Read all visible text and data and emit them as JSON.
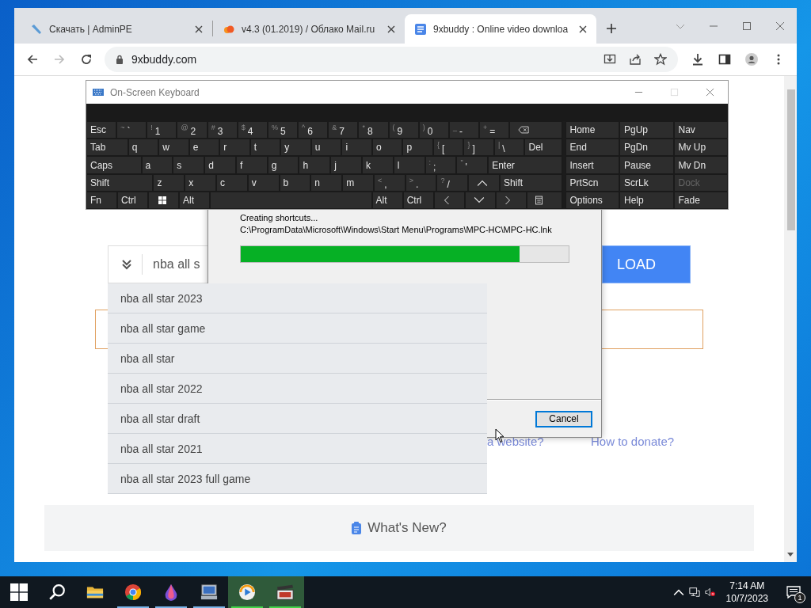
{
  "browser": {
    "tabs": [
      {
        "title": "Скачать | AdminPE",
        "selected": false,
        "kind": "pen"
      },
      {
        "title": "v4.3 (01.2019) / Облако Mail.ru",
        "selected": false,
        "kind": "cloud"
      },
      {
        "title": "9xbuddy : Online video downloa",
        "selected": true,
        "kind": "doc"
      }
    ],
    "address": "9xbuddy.com"
  },
  "page": {
    "search": {
      "value": "nba all s"
    },
    "download_button": "LOAD",
    "suggestions": [
      "nba all star 2023",
      "nba all star game",
      "nba all star",
      "nba all star 2022",
      "nba all star draft",
      "nba all star 2021",
      "nba all star 2023 full game"
    ],
    "links": [
      "a website?",
      "How to donate?"
    ],
    "whats_new": "What's New?"
  },
  "keyboard": {
    "title": "On-Screen Keyboard",
    "rows": [
      [
        {
          "label": "Esc",
          "kind": "key"
        },
        {
          "shift": "~",
          "label": "`",
          "kind": "key"
        },
        {
          "shift": "!",
          "label": "1",
          "kind": "key"
        },
        {
          "shift": "@",
          "label": "2",
          "kind": "key"
        },
        {
          "shift": "#",
          "label": "3",
          "kind": "key"
        },
        {
          "shift": "$",
          "label": "4",
          "kind": "key"
        },
        {
          "shift": "%",
          "label": "5",
          "kind": "key"
        },
        {
          "shift": "^",
          "label": "6",
          "kind": "key"
        },
        {
          "shift": "&",
          "label": "7",
          "kind": "key"
        },
        {
          "shift": "*",
          "label": "8",
          "kind": "key"
        },
        {
          "shift": "(",
          "label": "9",
          "kind": "key"
        },
        {
          "shift": ")",
          "label": "0",
          "kind": "key"
        },
        {
          "shift": "_",
          "label": "-",
          "kind": "key"
        },
        {
          "shift": "+",
          "label": "=",
          "kind": "key"
        },
        {
          "kind": "backspace"
        }
      ],
      [
        {
          "label": "Tab",
          "kind": "tab"
        },
        {
          "label": "q",
          "kind": "key"
        },
        {
          "label": "w",
          "kind": "key"
        },
        {
          "label": "e",
          "kind": "key"
        },
        {
          "label": "r",
          "kind": "key"
        },
        {
          "label": "t",
          "kind": "key"
        },
        {
          "label": "y",
          "kind": "key"
        },
        {
          "label": "u",
          "kind": "key"
        },
        {
          "label": "i",
          "kind": "key"
        },
        {
          "label": "o",
          "kind": "key"
        },
        {
          "label": "p",
          "kind": "key"
        },
        {
          "shift": "{",
          "label": "[",
          "kind": "key"
        },
        {
          "shift": "}",
          "label": "]",
          "kind": "key"
        },
        {
          "shift": "|",
          "label": "\\",
          "kind": "key"
        },
        {
          "label": "Del",
          "kind": "del"
        }
      ],
      [
        {
          "label": "Caps",
          "kind": "caps"
        },
        {
          "label": "a",
          "kind": "key"
        },
        {
          "label": "s",
          "kind": "key"
        },
        {
          "label": "d",
          "kind": "key"
        },
        {
          "label": "f",
          "kind": "key"
        },
        {
          "label": "g",
          "kind": "key"
        },
        {
          "label": "h",
          "kind": "key"
        },
        {
          "label": "j",
          "kind": "key"
        },
        {
          "label": "k",
          "kind": "key"
        },
        {
          "label": "l",
          "kind": "key"
        },
        {
          "shift": ":",
          "label": ";",
          "kind": "key"
        },
        {
          "shift": "\"",
          "label": "'",
          "kind": "key"
        },
        {
          "label": "Enter",
          "kind": "enter"
        }
      ],
      [
        {
          "label": "Shift",
          "kind": "lshift"
        },
        {
          "label": "z",
          "kind": "key"
        },
        {
          "label": "x",
          "kind": "key"
        },
        {
          "label": "c",
          "kind": "key"
        },
        {
          "label": "v",
          "kind": "key"
        },
        {
          "label": "b",
          "kind": "key"
        },
        {
          "label": "n",
          "kind": "key"
        },
        {
          "label": "m",
          "kind": "key"
        },
        {
          "shift": "<",
          "label": ",",
          "kind": "key"
        },
        {
          "shift": ">",
          "label": ".",
          "kind": "key"
        },
        {
          "shift": "?",
          "label": "/",
          "kind": "key"
        },
        {
          "kind": "up"
        },
        {
          "label": "Shift",
          "kind": "rshift"
        }
      ],
      [
        {
          "label": "Fn",
          "kind": "key"
        },
        {
          "label": "Ctrl",
          "kind": "key"
        },
        {
          "kind": "windows"
        },
        {
          "label": "Alt",
          "kind": "key"
        },
        {
          "kind": "space"
        },
        {
          "label": "Alt",
          "kind": "key"
        },
        {
          "label": "Ctrl",
          "kind": "key"
        },
        {
          "kind": "left"
        },
        {
          "kind": "down"
        },
        {
          "kind": "right"
        },
        {
          "kind": "menu"
        }
      ]
    ],
    "nav": [
      [
        {
          "label": "Home",
          "disabled": false
        },
        {
          "label": "PgUp",
          "disabled": false
        },
        {
          "label": "Nav",
          "disabled": false
        }
      ],
      [
        {
          "label": "End",
          "disabled": false
        },
        {
          "label": "PgDn",
          "disabled": false
        },
        {
          "label": "Mv Up",
          "disabled": false
        }
      ],
      [
        {
          "label": "Insert",
          "disabled": false
        },
        {
          "label": "Pause",
          "disabled": false
        },
        {
          "label": "Mv Dn",
          "disabled": false
        }
      ],
      [
        {
          "label": "PrtScn",
          "disabled": false
        },
        {
          "label": "ScrLk",
          "disabled": false
        },
        {
          "label": "Dock",
          "disabled": true
        }
      ],
      [
        {
          "label": "Options",
          "disabled": false
        },
        {
          "label": "Help",
          "disabled": false
        },
        {
          "label": "Fade",
          "disabled": false
        }
      ]
    ]
  },
  "installer": {
    "status": "Creating shortcuts...",
    "path": "C:\\ProgramData\\Microsoft\\Windows\\Start Menu\\Programs\\MPC-HC\\MPC-HC.lnk",
    "progress": {
      "level": 0.85
    },
    "cancel": "Cancel"
  },
  "taskbar": {
    "apps": [
      {
        "kind": "folder",
        "selected": false
      },
      {
        "kind": "browser",
        "selected": false,
        "color": "#7ab4e8"
      },
      {
        "kind": "drop",
        "selected": false,
        "color": "#7ab4e8"
      },
      {
        "kind": "monitor",
        "selected": false,
        "color": "#7ab4e8"
      },
      {
        "kind": "player",
        "selected": true,
        "color": "#44d34a"
      },
      {
        "kind": "clapper",
        "selected": true,
        "color": "#44d34a"
      }
    ],
    "time": "7:14 AM",
    "date": "10/7/2023",
    "notifications": "1"
  }
}
